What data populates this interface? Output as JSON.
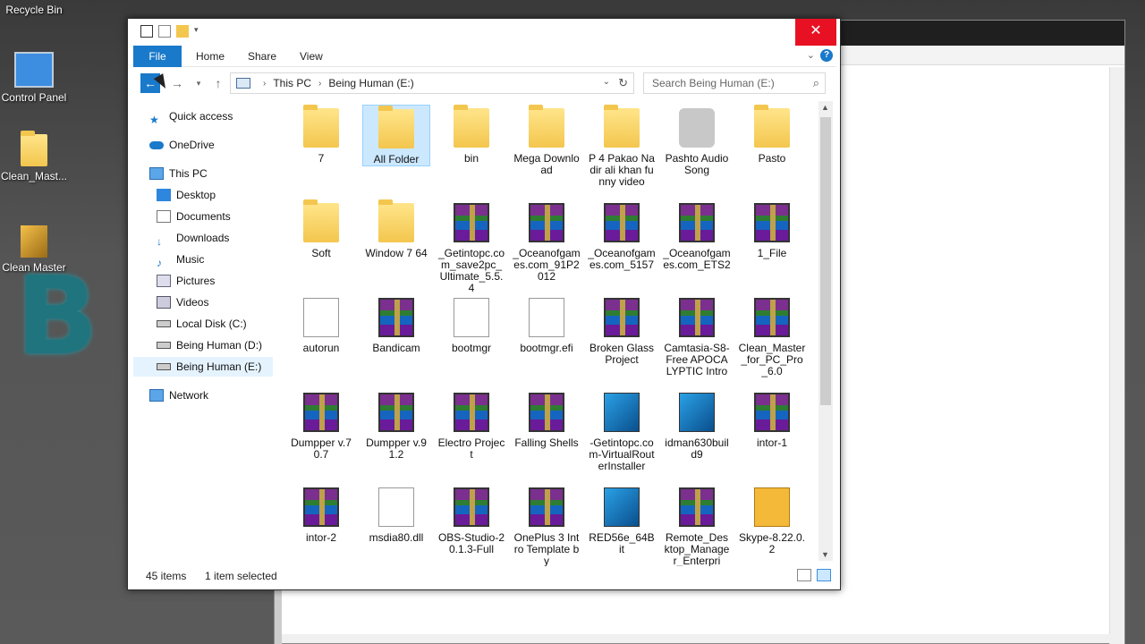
{
  "desktop": {
    "icons": [
      {
        "label": "Recycle Bin",
        "icon": "recycle-bin-icon"
      },
      {
        "label": "Control Panel",
        "icon": "control-panel-icon"
      },
      {
        "label": "Clean_Mast...",
        "icon": "folder-icon"
      },
      {
        "label": "Clean Master",
        "icon": "broom-icon"
      }
    ]
  },
  "explorer": {
    "close_glyph": "✕",
    "ribbon_tabs": [
      "File",
      "Home",
      "Share",
      "View"
    ],
    "help_glyph": "?",
    "breadcrumb": [
      "This PC",
      "Being Human (E:)"
    ],
    "search_placeholder": "Search Being Human (E:)",
    "nav_items": [
      {
        "label": "Quick access",
        "icon": "star-icon"
      },
      {
        "label": "OneDrive",
        "icon": "cloud-icon"
      },
      {
        "label": "This PC",
        "icon": "computer-icon"
      },
      {
        "label": "Desktop",
        "icon": "desktop-icon"
      },
      {
        "label": "Documents",
        "icon": "documents-icon"
      },
      {
        "label": "Downloads",
        "icon": "downloads-icon"
      },
      {
        "label": "Music",
        "icon": "music-icon"
      },
      {
        "label": "Pictures",
        "icon": "pictures-icon"
      },
      {
        "label": "Videos",
        "icon": "videos-icon"
      },
      {
        "label": "Local Disk (C:)",
        "icon": "drive-icon"
      },
      {
        "label": "Being Human (D:)",
        "icon": "drive-icon"
      },
      {
        "label": "Being Human (E:)",
        "icon": "drive-icon",
        "selected": true
      },
      {
        "label": "Network",
        "icon": "network-icon"
      }
    ],
    "files": [
      {
        "name": "7",
        "type": "folder"
      },
      {
        "name": "All Folder",
        "type": "folder",
        "selected": true
      },
      {
        "name": "bin",
        "type": "folder"
      },
      {
        "name": "Mega Download",
        "type": "folder"
      },
      {
        "name": "P 4 Pakao Nadir ali khan funny video",
        "type": "folder"
      },
      {
        "name": "Pashto Audio Song",
        "type": "usb"
      },
      {
        "name": "Pasto",
        "type": "folder"
      },
      {
        "name": "Soft",
        "type": "folder"
      },
      {
        "name": "Window 7 64",
        "type": "folder"
      },
      {
        "name": "_Getintopc.com_save2pc_Ultimate_5.5.4",
        "type": "rar"
      },
      {
        "name": "_Oceanofgames.com_91P2012",
        "type": "rar"
      },
      {
        "name": "_Oceanofgames.com_5157",
        "type": "rar"
      },
      {
        "name": "_Oceanofgames.com_ETS2",
        "type": "rar"
      },
      {
        "name": "1_File",
        "type": "rar"
      },
      {
        "name": "autorun",
        "type": "doc"
      },
      {
        "name": "Bandicam",
        "type": "rar"
      },
      {
        "name": "bootmgr",
        "type": "doc"
      },
      {
        "name": "bootmgr.efi",
        "type": "doc"
      },
      {
        "name": "Broken Glass Project",
        "type": "rar"
      },
      {
        "name": "Camtasia-S8-Free APOCALYPTIC Intro",
        "type": "rar"
      },
      {
        "name": "Clean_Master_for_PC_Pro_6.0",
        "type": "rar"
      },
      {
        "name": "Dumpper v.70.7",
        "type": "rar"
      },
      {
        "name": "Dumpper v.91.2",
        "type": "rar"
      },
      {
        "name": "Electro Project",
        "type": "rar"
      },
      {
        "name": "Falling Shells",
        "type": "rar"
      },
      {
        "name": "-Getintopc.com-VirtualRouterInstaller",
        "type": "setup"
      },
      {
        "name": "idman630build9",
        "type": "setup"
      },
      {
        "name": "intor-1",
        "type": "rar"
      },
      {
        "name": "intor-2",
        "type": "rar"
      },
      {
        "name": "msdia80.dll",
        "type": "doc"
      },
      {
        "name": "OBS-Studio-20.1.3-Full",
        "type": "rar"
      },
      {
        "name": "OnePlus 3 Intro Template by",
        "type": "rar"
      },
      {
        "name": "RED56e_64Bit",
        "type": "setup"
      },
      {
        "name": "Remote_Desktop_Manager_Enterpri",
        "type": "rar"
      },
      {
        "name": "Skype-8.22.0.2",
        "type": "box"
      }
    ],
    "status": {
      "count": "45 items",
      "selection": "1 item selected"
    }
  }
}
